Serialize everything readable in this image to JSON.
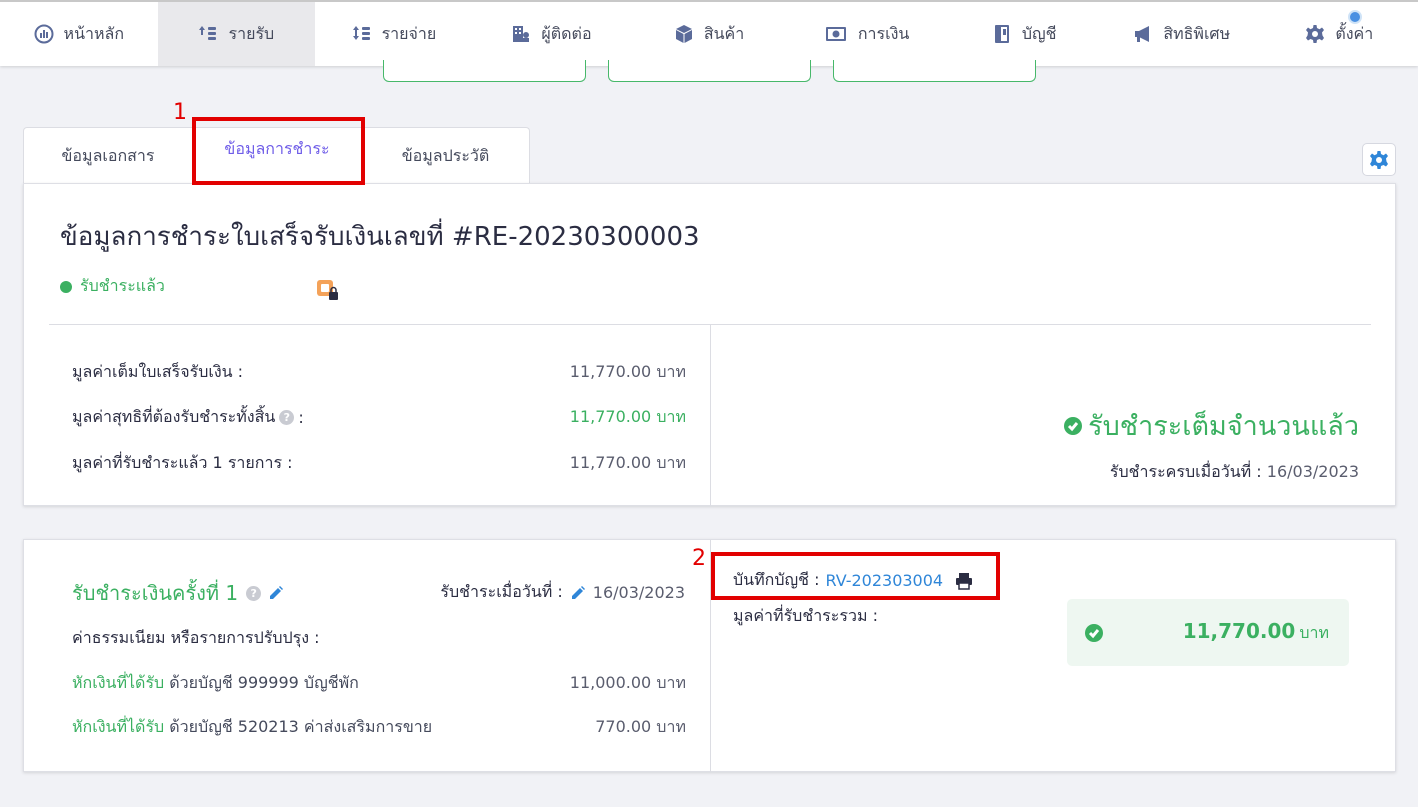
{
  "nav": [
    {
      "label": "หน้าหลัก",
      "icon": "dashboard-icon"
    },
    {
      "label": "รายรับ",
      "icon": "income-icon"
    },
    {
      "label": "รายจ่าย",
      "icon": "expense-icon"
    },
    {
      "label": "ผู้ติดต่อ",
      "icon": "contacts-icon"
    },
    {
      "label": "สินค้า",
      "icon": "product-box-icon"
    },
    {
      "label": "การเงิน",
      "icon": "money-icon"
    },
    {
      "label": "บัญชี",
      "icon": "book-icon"
    },
    {
      "label": "สิทธิพิเศษ",
      "icon": "megaphone-icon"
    },
    {
      "label": "ตั้งค่า",
      "icon": "gear-icon"
    }
  ],
  "tabs": [
    "ข้อมูลเอกสาร",
    "ข้อมูลการชำระ",
    "ข้อมูลประวัติ"
  ],
  "summary": {
    "title": "ข้อมูลการชำระใบเสร็จรับเงินเลขที่ #RE-20230300003",
    "status": "รับชำระแล้ว",
    "rows": [
      {
        "label": "มูลค่าเต็มใบเสร็จรับเงิน :",
        "value": "11,770.00 บาท"
      },
      {
        "label": "มูลค่าสุทธิที่ต้องรับชำระทั้งสิ้น",
        "suffix": ":",
        "value": "11,770.00 บาท"
      },
      {
        "label": "มูลค่าที่รับชำระแล้ว 1 รายการ :",
        "value": "11,770.00 บาท"
      }
    ],
    "paid_full": "รับชำระเต็มจำนวนแล้ว",
    "paid_date_label": "รับชำระครบเมื่อวันที่ :",
    "paid_date": "16/03/2023"
  },
  "payment": {
    "title": "รับชำระเงินครั้งที่ 1",
    "date_label": "รับชำระเมื่อวันที่ :",
    "date": "16/03/2023",
    "fee_label": "ค่าธรรมเนียม หรือรายการปรับปรุง :",
    "deductions": [
      {
        "link": "หักเงินที่ได้รับ",
        "text": "ด้วยบัญชี 999999 บัญชีพัก",
        "value": "11,000.00 บาท"
      },
      {
        "link": "หักเงินที่ได้รับ",
        "text": "ด้วยบัญชี 520213 ค่าส่งเสริมการขาย",
        "value": "770.00 บาท"
      }
    ],
    "journal_label": "บันทึกบัญชี :",
    "journal_no": "RV-202303004",
    "total_label": "มูลค่าที่รับชำระรวม :",
    "total_amount": "11,770.00",
    "total_unit": "บาท"
  },
  "annotations": [
    "1",
    "2"
  ],
  "colors": {
    "green": "#3bb061",
    "link_blue": "#2f86d8",
    "tab_active": "#6f5de8",
    "annotation": "#e20000"
  }
}
